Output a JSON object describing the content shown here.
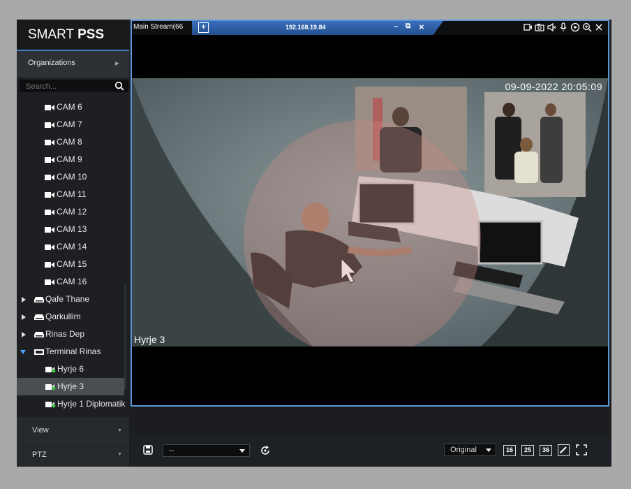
{
  "app": {
    "logo_light": "SMART ",
    "logo_bold": "PSS"
  },
  "sidebar": {
    "organizations_label": "Organizations",
    "search_placeholder": "Search...",
    "cameras": [
      "CAM 6",
      "CAM 7",
      "CAM 8",
      "CAM 9",
      "CAM 10",
      "CAM 11",
      "CAM 12",
      "CAM 13",
      "CAM 14",
      "CAM 15",
      "CAM 16"
    ],
    "groups": [
      "Qafe Thane",
      "Qarkullim",
      "Rinas Dep",
      "Terminal Rinas"
    ],
    "terminal_children": [
      "Hyrje 6",
      "Hyrje 3",
      "Hyrje 1 Diplomatik"
    ],
    "selected_item": "Hyrje 3",
    "view_label": "View",
    "ptz_label": "PTZ"
  },
  "video": {
    "stream_label": "Main Stream(66",
    "pin_symbol": "+",
    "ip": "192.168.19.84",
    "minimize": "–",
    "restore": "⧉",
    "close": "×",
    "timestamp": "09-09-2022 20:05:09",
    "camera_name": "Hyrje 3",
    "top_icons": [
      "record-icon",
      "snapshot-icon",
      "audio-icon",
      "microphone-icon",
      "play-icon",
      "zoom-icon",
      "close-icon"
    ]
  },
  "toolbar": {
    "layout_value": "--",
    "ratio_value": "Original",
    "grid_options": [
      "16",
      "25",
      "36"
    ]
  },
  "colors": {
    "accent": "#3a6fbd",
    "selected_bg": "#4a4d52",
    "background": "#1b1d20"
  }
}
